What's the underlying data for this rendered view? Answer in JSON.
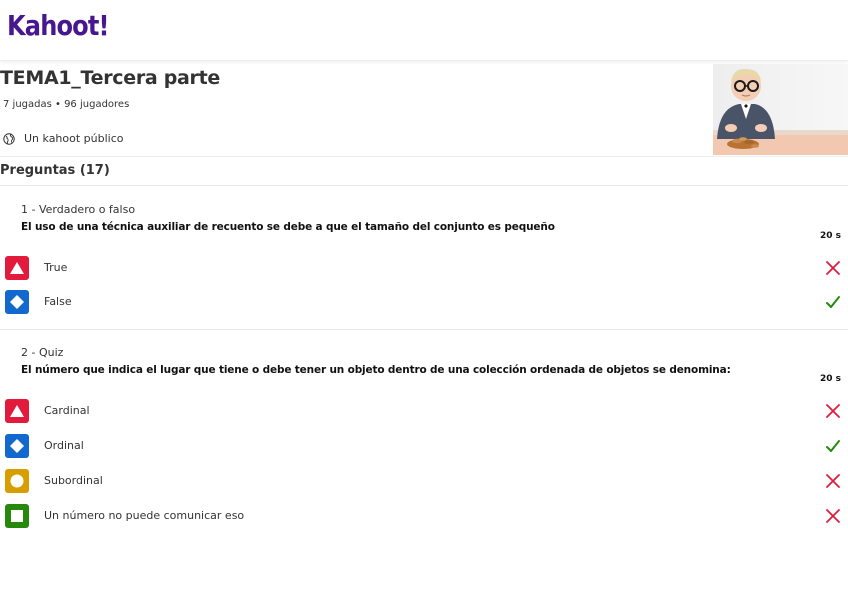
{
  "app": {
    "logo_text": "Kahoot!",
    "brand_color": "#46178f"
  },
  "kahoot": {
    "title": "TEMA1_Tercera parte",
    "meta": "7 jugadas • 96 jugadores",
    "visibility": "Un kahoot público"
  },
  "questions_heading": "Preguntas (17)",
  "questions": [
    {
      "type_label": "1 - Verdadero o falso",
      "text": "El uso de una técnica auxiliar de recuento se debe a que el tamaño del conjunto es pequeño",
      "time": "20 s",
      "answers": [
        {
          "label": "True",
          "shape": "triangle-icon",
          "color": "#e21b3c",
          "correct": false
        },
        {
          "label": "False",
          "shape": "diamond-icon",
          "color": "#1368ce",
          "correct": true
        }
      ]
    },
    {
      "type_label": "2 - Quiz",
      "text": "El número que indica el lugar que tiene o debe tener un objeto dentro de una colección ordenada de objetos  se denomina:",
      "time": "20 s",
      "answers": [
        {
          "label": "Cardinal",
          "shape": "triangle-icon",
          "color": "#e21b3c",
          "correct": false
        },
        {
          "label": "Ordinal",
          "shape": "diamond-icon",
          "color": "#1368ce",
          "correct": true
        },
        {
          "label": "Subordinal",
          "shape": "circle-icon",
          "color": "#d89e00",
          "correct": false
        },
        {
          "label": "Un número no puede comunicar eso",
          "shape": "square-icon",
          "color": "#26890c",
          "correct": false
        }
      ]
    }
  ],
  "status_colors": {
    "correct": "#26890c",
    "incorrect": "#e21b3c"
  }
}
